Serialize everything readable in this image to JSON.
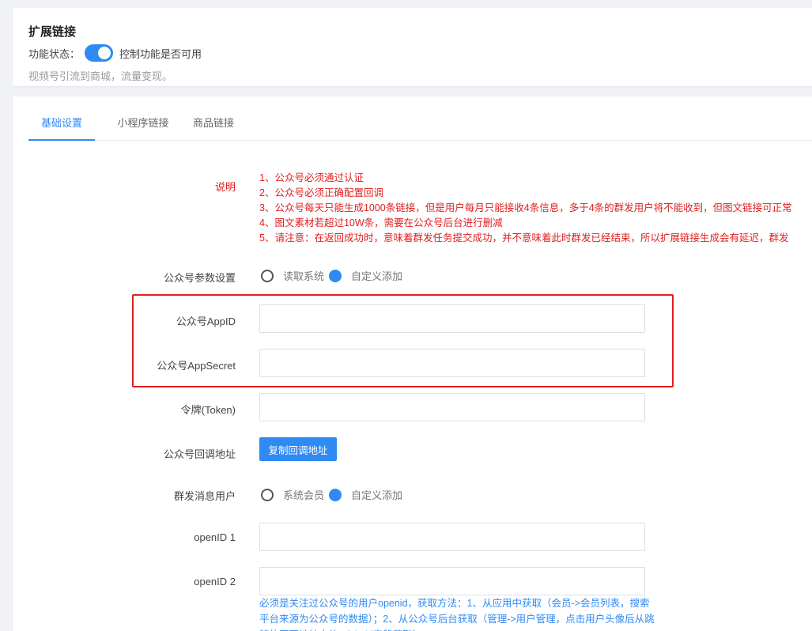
{
  "extension": {
    "title": "扩展链接",
    "status_label": "功能状态：",
    "toggle_on": true,
    "status_desc": "控制功能是否可用",
    "subtitle": "视频号引流到商城，流量变现。"
  },
  "tabs": [
    {
      "label": "基础设置",
      "active": true
    },
    {
      "label": "小程序链接",
      "active": false
    },
    {
      "label": "商品链接",
      "active": false
    }
  ],
  "form": {
    "notes_label": "说明",
    "notes": [
      "1、公众号必须通过认证",
      "2、公众号必须正确配置回调",
      "3、公众号每天只能生成1000条链接，但是用户每月只能接收4条信息，多于4条的群发用户将不能收到，但图文链接可正常",
      "4、图文素材若超过10W条，需要在公众号后台进行删减",
      "5、请注意：在返回成功时，意味着群发任务提交成功，并不意味着此时群发已经结束，所以扩展链接生成会有延迟，群发"
    ],
    "param_label": "公众号参数设置",
    "param_options": [
      "读取系统",
      "自定义添加"
    ],
    "param_selected": "自定义添加",
    "appid_label": "公众号AppID",
    "appid_value": "",
    "appsecret_label": "公众号AppSecret",
    "appsecret_value": "",
    "token_label": "令牌(Token)",
    "token_value": "",
    "callback_label": "公众号回调地址",
    "callback_button": "复制回调地址",
    "mass_label": "群发消息用户",
    "mass_options": [
      "系统会员",
      "自定义添加"
    ],
    "mass_selected": "自定义添加",
    "openid1_label": "openID 1",
    "openid1_value": "",
    "openid2_label": "openID 2",
    "openid2_value": "",
    "help_text": "必须是关注过公众号的用户openid，获取方法：1、从应用中获取（会员->会员列表，搜索平台来源为公众号的数据）；2、从公众号后台获取（管理->用户管理，点击用户头像后从跳转的页面地址中的tofakeid字段获取）"
  },
  "colors": {
    "accent": "#2f8af4",
    "warning": "#e02020"
  }
}
